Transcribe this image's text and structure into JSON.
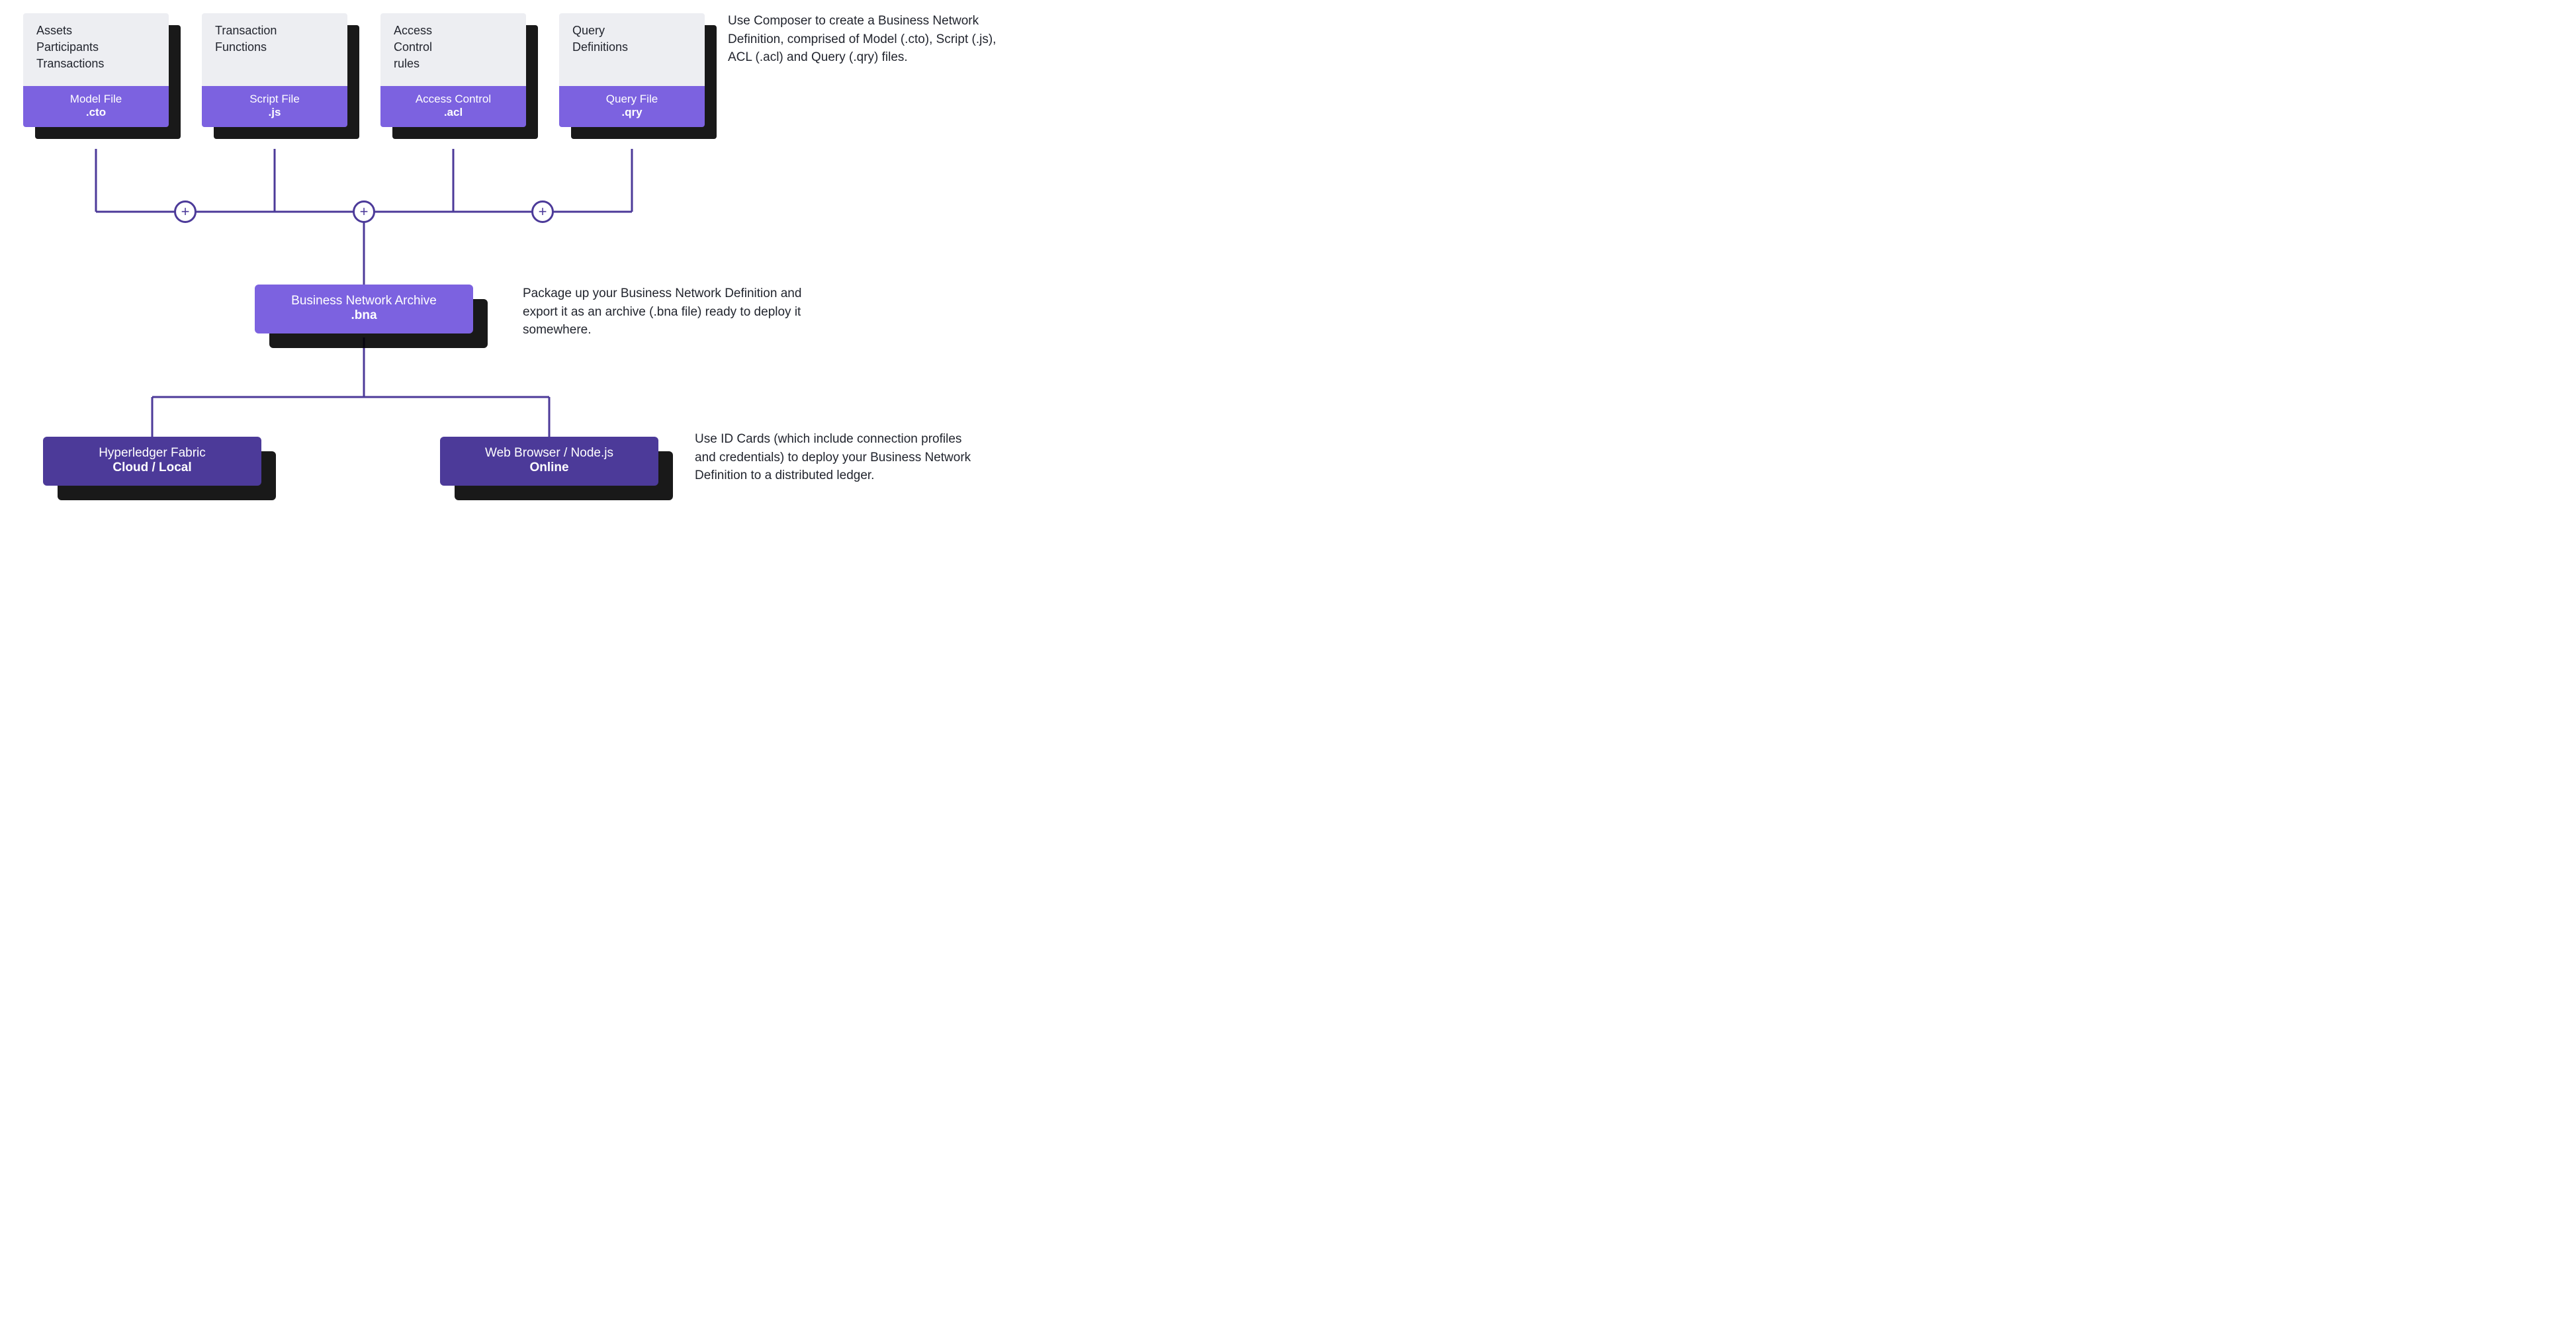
{
  "files": [
    {
      "desc_lines": [
        "Assets",
        "Participants",
        "Transactions"
      ],
      "label": "Model File",
      "ext": ".cto"
    },
    {
      "desc_lines": [
        "Transaction",
        "Functions"
      ],
      "label": "Script File",
      "ext": ".js"
    },
    {
      "desc_lines": [
        "Access",
        "Control",
        "rules"
      ],
      "label": "Access Control",
      "ext": ".acl"
    },
    {
      "desc_lines": [
        "Query",
        "Definitions"
      ],
      "label": "Query File",
      "ext": ".qry"
    }
  ],
  "bna": {
    "label": "Business Network Archive",
    "ext": ".bna"
  },
  "deploy": [
    {
      "label": "Hyperledger Fabric",
      "sub": "Cloud / Local"
    },
    {
      "label": "Web Browser / Node.js",
      "sub": "Online"
    }
  ],
  "descriptions": {
    "top": "Use Composer to create a Business Network Definition, comprised of Model (.cto), Script (.js), ACL (.acl) and Query (.qry) files.",
    "middle": "Package up your Business Network Definition and export it as an archive (.bna file) ready to deploy it somewhere.",
    "bottom": "Use ID Cards (which include connection profiles and credentials) to deploy your Business Network Definition to a distributed ledger."
  },
  "plus_symbol": "+"
}
